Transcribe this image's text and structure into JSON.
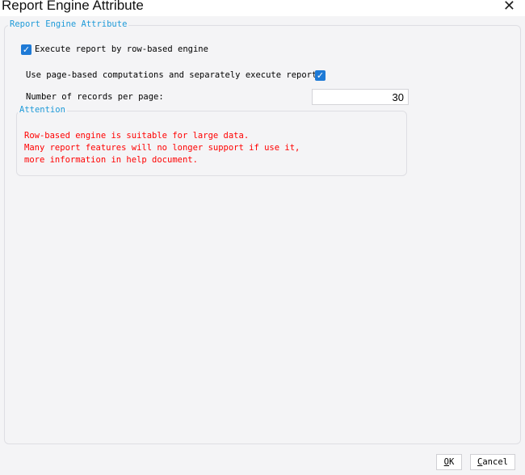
{
  "window": {
    "title": "Report Engine Attribute",
    "close_icon": "close-icon"
  },
  "group": {
    "legend": "Report Engine Attribute"
  },
  "row_engine": {
    "label": "Execute report by row-based engine",
    "checked": true
  },
  "page_based": {
    "label": "Use page-based computations and separately execute report:",
    "checked": true
  },
  "records": {
    "label": "Number of records per page:",
    "value": "30"
  },
  "attention": {
    "legend": "Attention",
    "lines": [
      "Row-based engine is suitable for large data.",
      "Many report features will no longer support if use it,",
      "more information in help document."
    ]
  },
  "buttons": {
    "ok_mnemonic": "O",
    "ok_rest": "K",
    "cancel_mnemonic": "C",
    "cancel_rest": "ancel"
  },
  "colors": {
    "accent": "#1e7ad6",
    "legend": "#1e9ad8",
    "warning": "#ff0000"
  }
}
